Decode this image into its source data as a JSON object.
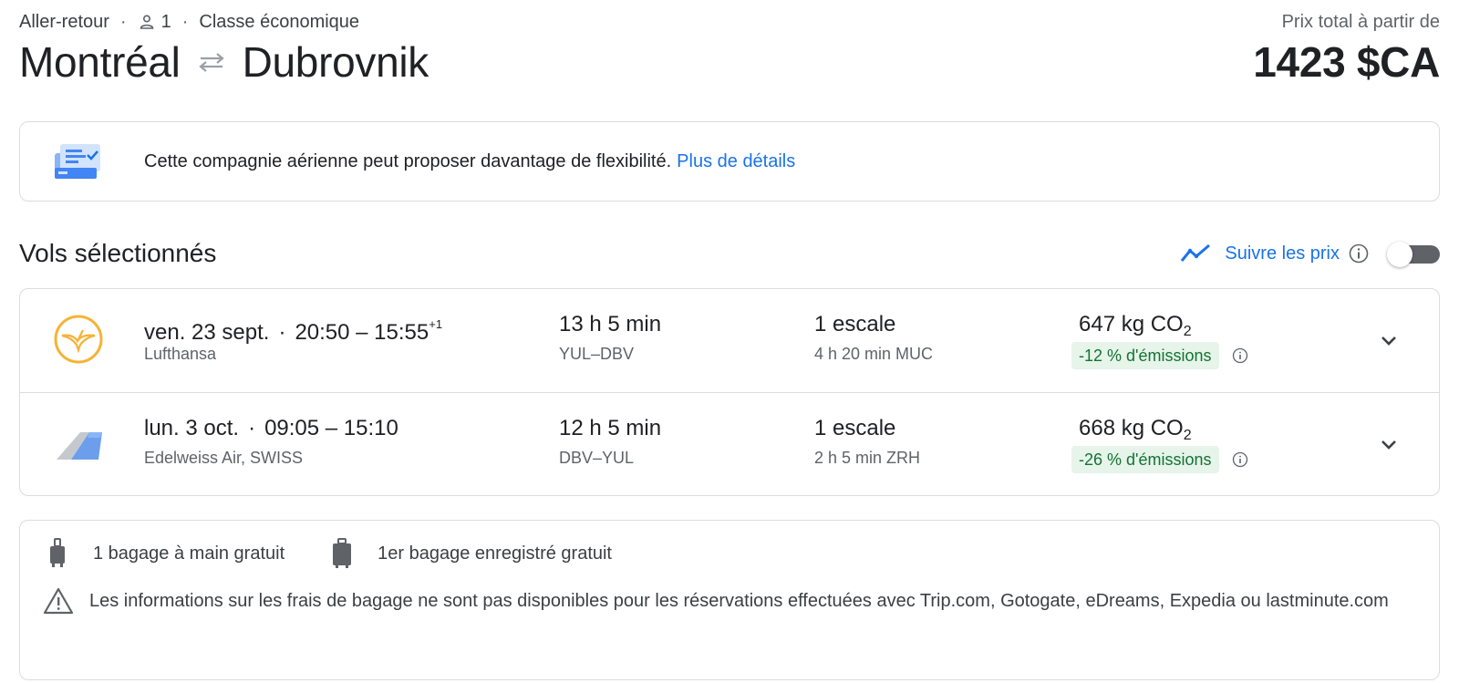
{
  "header": {
    "trip_type": "Aller-retour",
    "separator": "·",
    "passengers": "1",
    "cabin_class": "Classe économique",
    "origin": "Montréal",
    "destination": "Dubrovnik",
    "price_label": "Prix total à partir de",
    "price": "1423 $CA"
  },
  "flexibility": {
    "message": "Cette compagnie aérienne peut proposer davantage de flexibilité.",
    "link": "Plus de détails"
  },
  "selected": {
    "title": "Vols sélectionnés",
    "track_label": "Suivre les prix",
    "track_enabled": false
  },
  "flights": [
    {
      "date": "ven. 23 sept.",
      "times": "20:50 – 15:55",
      "day_offset": "+1",
      "airline": "Lufthansa",
      "duration": "13 h 5 min",
      "route": "YUL–DBV",
      "stops": "1 escale",
      "layover": "4 h 20 min MUC",
      "co2": "647 kg CO",
      "co2_sub": "2",
      "emissions": "-12 % d'émissions",
      "logo_icon": "lufthansa-crane-icon"
    },
    {
      "date": "lun. 3 oct.",
      "times": "09:05 – 15:10",
      "day_offset": "",
      "airline": "Edelweiss Air, SWISS",
      "duration": "12 h 5 min",
      "route": "DBV–YUL",
      "stops": "1 escale",
      "layover": "2 h 5 min ZRH",
      "co2": "668 kg CO",
      "co2_sub": "2",
      "emissions": "-26 % d'émissions",
      "logo_icon": "edelweiss-tail-icon"
    }
  ],
  "baggage": {
    "carry_on": "1 bagage à main gratuit",
    "checked": "1er bagage enregistré gratuit",
    "warning": "Les informations sur les frais de bagage ne sont pas disponibles pour les réservations effectuées avec Trip.com, Gotogate, eDreams, Expedia ou lastminute.com"
  },
  "colors": {
    "link_blue": "#1a73e8",
    "emissions_bg": "#e6f4ea",
    "emissions_text": "#137333",
    "lufthansa_yellow": "#f5b335",
    "border": "#dadce0"
  }
}
